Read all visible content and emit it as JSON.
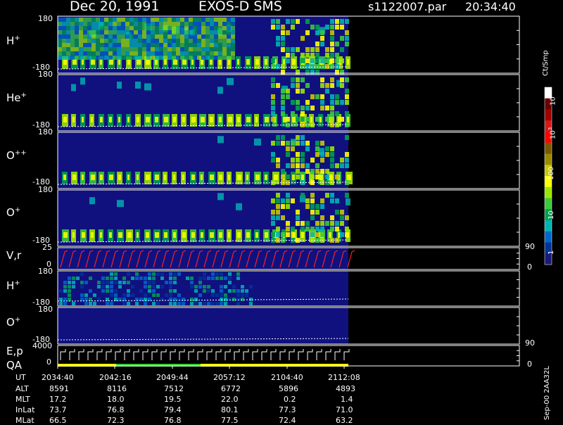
{
  "header": {
    "date": "Dec 20, 1991",
    "mission": "EXOS-D  SMS",
    "file": "s1122007.par",
    "time": "20:34:40"
  },
  "panels": [
    {
      "label": "H",
      "sup": "+",
      "top_tick": "180",
      "bottom_tick": "-180"
    },
    {
      "label": "He",
      "sup": "+",
      "top_tick": "180",
      "bottom_tick": "-180"
    },
    {
      "label": "O",
      "sup": "++",
      "top_tick": "180",
      "bottom_tick": "-180"
    },
    {
      "label": "O",
      "sup": "+",
      "top_tick": "180",
      "bottom_tick": "-180"
    },
    {
      "label": "V,r",
      "sup": "",
      "top_tick": "25",
      "bottom_tick": "0",
      "right_top": "90",
      "right_bottom": "0"
    },
    {
      "label": "H",
      "sup": "+",
      "top_tick": "180",
      "bottom_tick": "-180"
    },
    {
      "label": "O",
      "sup": "+",
      "top_tick": "180",
      "bottom_tick": "-180"
    },
    {
      "label": "E,p",
      "sup": "",
      "label2": "QA",
      "top_tick": "4000",
      "bottom_tick": "0",
      "right_top": "90",
      "right_bottom": "0"
    }
  ],
  "colorbar": {
    "unit": "Ct/Smp",
    "labels": [
      {
        "base": "10",
        "exp": "4"
      },
      {
        "base": "10",
        "exp": "3"
      },
      {
        "base": "100",
        "exp": ""
      },
      {
        "base": "10",
        "exp": ""
      },
      {
        "base": "1",
        "exp": ""
      }
    ],
    "colors": [
      "#ffffff",
      "#6b0000",
      "#a00000",
      "#d41a1a",
      "#ff0000",
      "#7a5800",
      "#9a8a00",
      "#c8c800",
      "#ffff00",
      "#9ae600",
      "#3cc83c",
      "#00a050",
      "#00b4b4",
      "#0066cc",
      "#003399",
      "#1a1a7a"
    ]
  },
  "footer_stamp": "Sep-00  2AA32L",
  "ephemeris": {
    "rows": [
      {
        "label": "UT",
        "values": [
          "2034:40",
          "2042:16",
          "2049:44",
          "2057:12",
          "2104:40",
          "2112:08"
        ]
      },
      {
        "label": "ALT",
        "values": [
          "8591",
          "8116",
          "7512",
          "6772",
          "5896",
          "4893"
        ]
      },
      {
        "label": "MLT",
        "values": [
          "17.2",
          "18.0",
          "19.5",
          "22.0",
          "0.2",
          "1.4"
        ]
      },
      {
        "label": "InLat",
        "values": [
          "73.7",
          "76.8",
          "79.4",
          "80.1",
          "77.3",
          "71.0"
        ]
      },
      {
        "label": "MLat",
        "values": [
          "66.5",
          "72.3",
          "76.8",
          "77.5",
          "72.4",
          "63.2"
        ]
      }
    ]
  },
  "chart_data": {
    "type": "heatmap",
    "title": "Dec 20, 1991   EXOS-D  SMS",
    "x_time_ticks": [
      "2034:40",
      "2042:16",
      "2049:44",
      "2057:12",
      "2104:40",
      "2112:08"
    ],
    "y_range_pitch": [
      -180,
      180
    ],
    "color_scale": "log",
    "color_range": [
      1,
      10000
    ],
    "color_unit": "Ct/Smp",
    "series": [
      {
        "name": "H+",
        "type": "heatmap",
        "ylim": [
          -180,
          180
        ]
      },
      {
        "name": "He+",
        "type": "heatmap",
        "ylim": [
          -180,
          180
        ]
      },
      {
        "name": "O++",
        "type": "heatmap",
        "ylim": [
          -180,
          180
        ]
      },
      {
        "name": "O+",
        "type": "heatmap",
        "ylim": [
          -180,
          180
        ]
      },
      {
        "name": "V,r",
        "type": "line",
        "ylim": [
          0,
          25
        ],
        "right_ylim": [
          0,
          90
        ]
      },
      {
        "name": "H+",
        "type": "heatmap",
        "ylim": [
          -180,
          180
        ]
      },
      {
        "name": "O+",
        "type": "heatmap",
        "ylim": [
          -180,
          180
        ]
      },
      {
        "name": "E,p QA",
        "type": "line",
        "ylim": [
          0,
          4000
        ],
        "right_ylim": [
          0,
          90
        ]
      }
    ]
  }
}
